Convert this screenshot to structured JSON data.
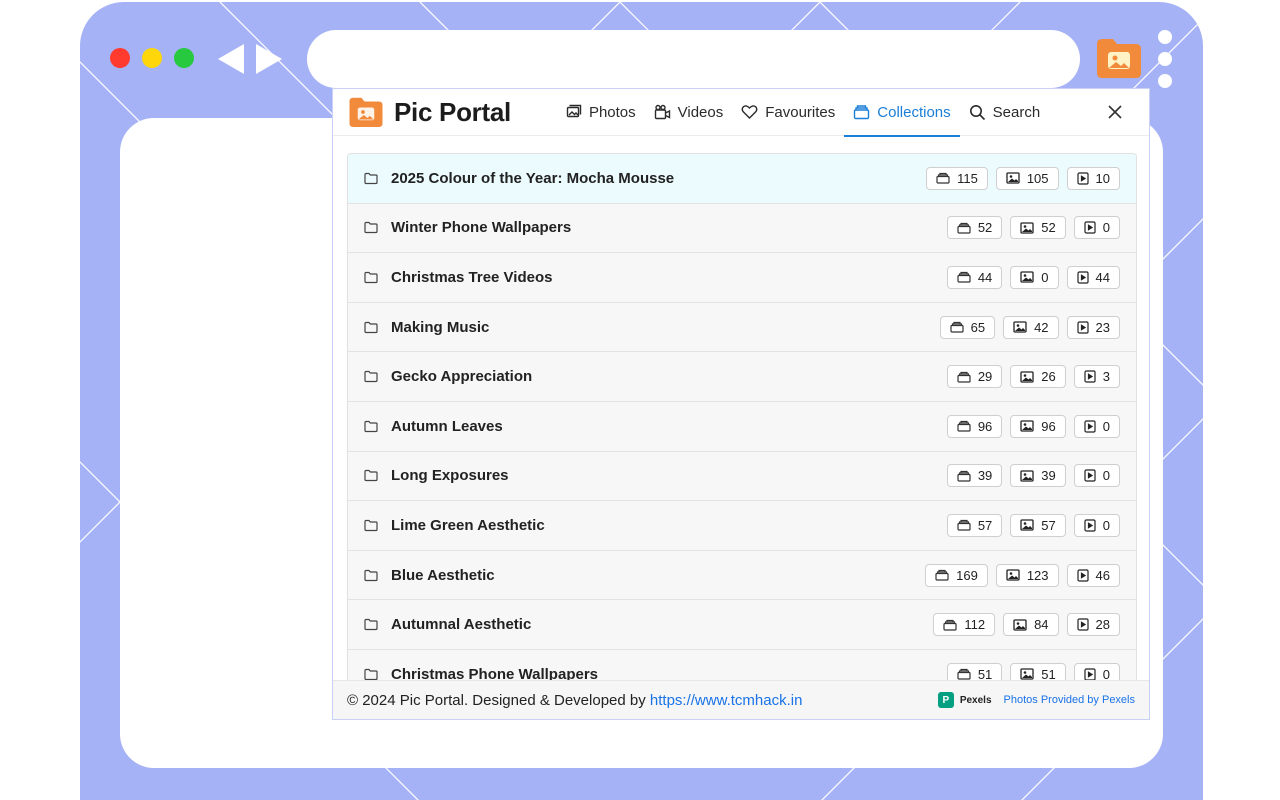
{
  "app": {
    "name": "Pic Portal"
  },
  "nav": {
    "items": [
      {
        "label": "Photos",
        "icon": "photos-icon",
        "active": false
      },
      {
        "label": "Videos",
        "icon": "videos-icon",
        "active": false
      },
      {
        "label": "Favourites",
        "icon": "heart-icon",
        "active": false
      },
      {
        "label": "Collections",
        "icon": "collections-icon",
        "active": true
      },
      {
        "label": "Search",
        "icon": "search-icon",
        "active": false
      }
    ]
  },
  "collections": [
    {
      "title": "2025 Colour of the Year: Mocha Mousse",
      "total": "115",
      "photos": "105",
      "videos": "10"
    },
    {
      "title": "Winter Phone Wallpapers",
      "total": "52",
      "photos": "52",
      "videos": "0"
    },
    {
      "title": "Christmas Tree Videos",
      "total": "44",
      "photos": "0",
      "videos": "44"
    },
    {
      "title": "Making Music",
      "total": "65",
      "photos": "42",
      "videos": "23"
    },
    {
      "title": "Gecko Appreciation",
      "total": "29",
      "photos": "26",
      "videos": "3"
    },
    {
      "title": "Autumn Leaves",
      "total": "96",
      "photos": "96",
      "videos": "0"
    },
    {
      "title": "Long Exposures",
      "total": "39",
      "photos": "39",
      "videos": "0"
    },
    {
      "title": "Lime Green Aesthetic",
      "total": "57",
      "photos": "57",
      "videos": "0"
    },
    {
      "title": "Blue Aesthetic",
      "total": "169",
      "photos": "123",
      "videos": "46"
    },
    {
      "title": "Autumnal Aesthetic",
      "total": "112",
      "photos": "84",
      "videos": "28"
    },
    {
      "title": "Christmas Phone Wallpapers",
      "total": "51",
      "photos": "51",
      "videos": "0"
    }
  ],
  "footer": {
    "copyright": "© 2024 Pic Portal. Designed & Developed by ",
    "link": "https://www.tcmhack.in",
    "pexels_logo": "P",
    "pexels_name": "Pexels",
    "pexels_credit": "Photos Provided by Pexels"
  },
  "colors": {
    "frame": "#a6b2f6",
    "accent": "#1a7fd8",
    "brand_orange": "#f28a3c",
    "close_red": "#ff3b30",
    "minimize_yellow": "#ffd60a",
    "maximize_green": "#27c93f",
    "pexels_green": "#05a081"
  }
}
